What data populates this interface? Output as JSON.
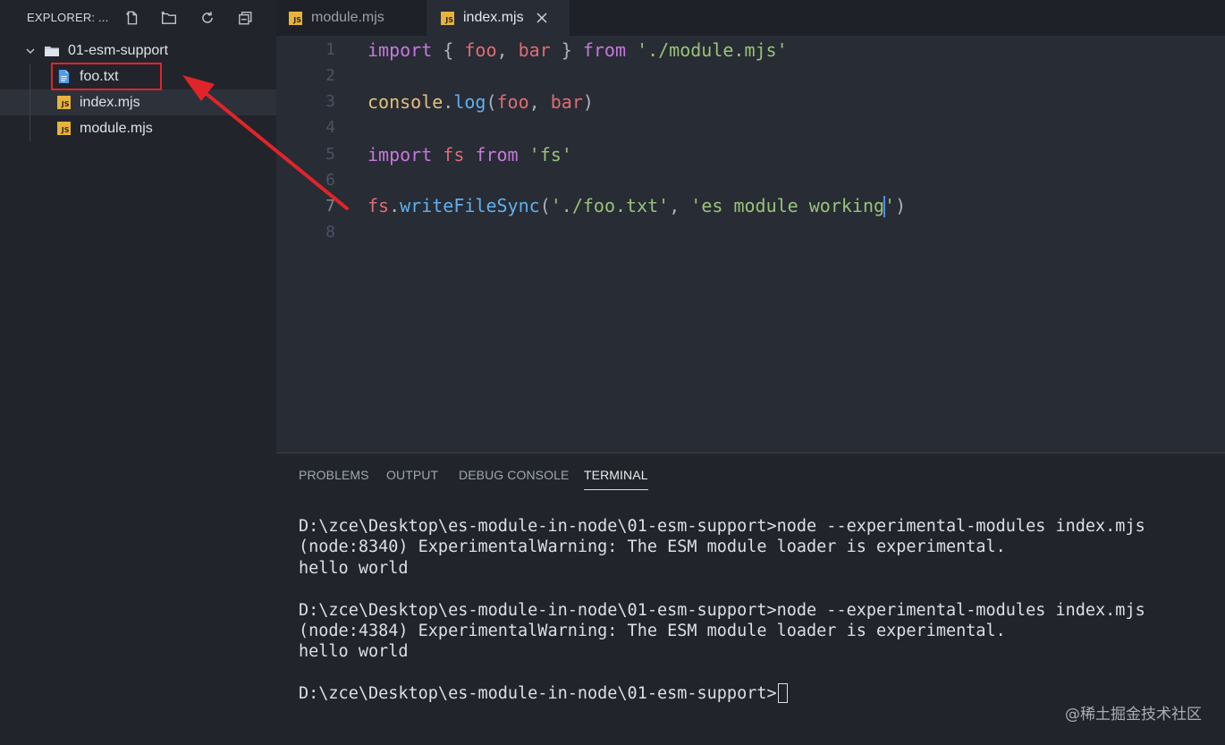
{
  "sidebar": {
    "title": "EXPLORER: ...",
    "folder": "01-esm-support",
    "files": [
      {
        "name": "foo.txt",
        "icon": "text-file-icon"
      },
      {
        "name": "index.mjs",
        "icon": "js-file-icon"
      },
      {
        "name": "module.mjs",
        "icon": "js-file-icon"
      }
    ],
    "js_badge": "JS"
  },
  "tabs": [
    {
      "label": "module.mjs",
      "active": false
    },
    {
      "label": "index.mjs",
      "active": true
    }
  ],
  "editor": {
    "line_numbers": [
      "1",
      "2",
      "3",
      "4",
      "5",
      "6",
      "7",
      "8"
    ],
    "lines": [
      "import { foo, bar } from './module.mjs'",
      "",
      "console.log(foo, bar)",
      "",
      "import fs from 'fs'",
      "",
      "fs.writeFileSync('./foo.txt', 'es module working')",
      ""
    ],
    "active_line": 7
  },
  "panel": {
    "tabs": [
      "PROBLEMS",
      "OUTPUT",
      "DEBUG CONSOLE",
      "TERMINAL"
    ],
    "active_tab": "TERMINAL",
    "terminal_lines": [
      "D:\\zce\\Desktop\\es-module-in-node\\01-esm-support>node --experimental-modules index.mjs",
      "(node:8340) ExperimentalWarning: The ESM module loader is experimental.",
      "hello world",
      "",
      "D:\\zce\\Desktop\\es-module-in-node\\01-esm-support>node --experimental-modules index.mjs",
      "(node:4384) ExperimentalWarning: The ESM module loader is experimental.",
      "hello world",
      "",
      "D:\\zce\\Desktop\\es-module-in-node\\01-esm-support>"
    ]
  },
  "watermark": "@稀土掘金技术社区",
  "colors": {
    "keyword": "#c678dd",
    "variable": "#e06c75",
    "string": "#98c379",
    "function": "#61afef",
    "object": "#e5c07b",
    "annotation": "#e0242a"
  }
}
